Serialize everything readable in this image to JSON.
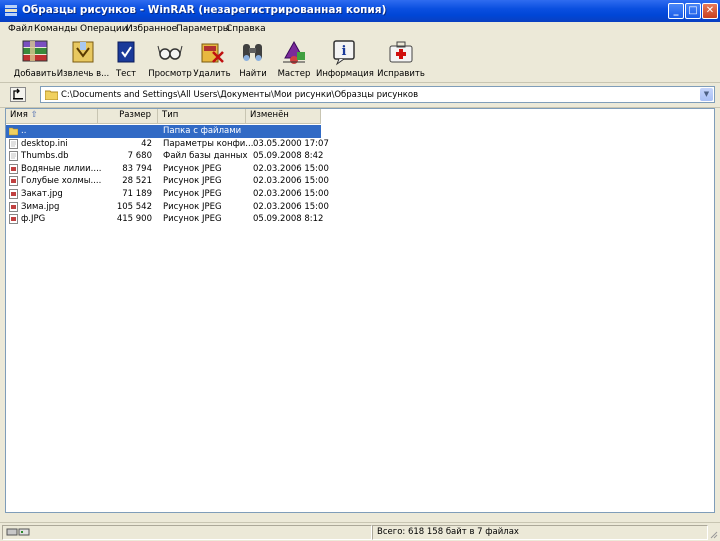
{
  "window": {
    "title": "Образцы рисунков - WinRAR (незарегистрированная копия)"
  },
  "menu": [
    "Файл",
    "Команды",
    "Операции",
    "Избранное",
    "Параметры",
    "Справка"
  ],
  "toolbar": [
    {
      "label": "Добавить",
      "icon": "add-archive-icon"
    },
    {
      "label": "Извлечь в...",
      "icon": "extract-icon"
    },
    {
      "label": "Тест",
      "icon": "test-icon"
    },
    {
      "label": "Просмотр",
      "icon": "view-icon"
    },
    {
      "label": "Удалить",
      "icon": "delete-icon"
    },
    {
      "label": "Найти",
      "icon": "find-icon"
    },
    {
      "label": "Мастер",
      "icon": "wizard-icon"
    },
    {
      "label": "Информация",
      "icon": "info-icon"
    },
    {
      "label": "Исправить",
      "icon": "repair-icon"
    }
  ],
  "address": {
    "path": "C:\\Documents and Settings\\All Users\\Документы\\Мои рисунки\\Образцы рисунков"
  },
  "columns": {
    "name": "Имя",
    "size": "Размер",
    "type": "Тип",
    "modified": "Изменён"
  },
  "files": [
    {
      "name": "..",
      "size": "",
      "type": "Папка с файлами",
      "modified": "",
      "selected": true
    },
    {
      "name": "desktop.ini",
      "size": "42",
      "type": "Параметры конфи...",
      "modified": "03.05.2000 17:07"
    },
    {
      "name": "Thumbs.db",
      "size": "7 680",
      "type": "Файл базы данных",
      "modified": "05.09.2008 8:42"
    },
    {
      "name": "Водяные лилии....",
      "size": "83 794",
      "type": "Рисунок JPEG",
      "modified": "02.03.2006 15:00"
    },
    {
      "name": "Голубые холмы....",
      "size": "28 521",
      "type": "Рисунок JPEG",
      "modified": "02.03.2006 15:00"
    },
    {
      "name": "Закат.jpg",
      "size": "71 189",
      "type": "Рисунок JPEG",
      "modified": "02.03.2006 15:00"
    },
    {
      "name": "Зима.jpg",
      "size": "105 542",
      "type": "Рисунок JPEG",
      "modified": "02.03.2006 15:00"
    },
    {
      "name": "ф.JPG",
      "size": "415 900",
      "type": "Рисунок JPEG",
      "modified": "05.09.2008 8:12"
    }
  ],
  "status": {
    "summary": "Всего: 618 158 байт в 7 файлах"
  }
}
